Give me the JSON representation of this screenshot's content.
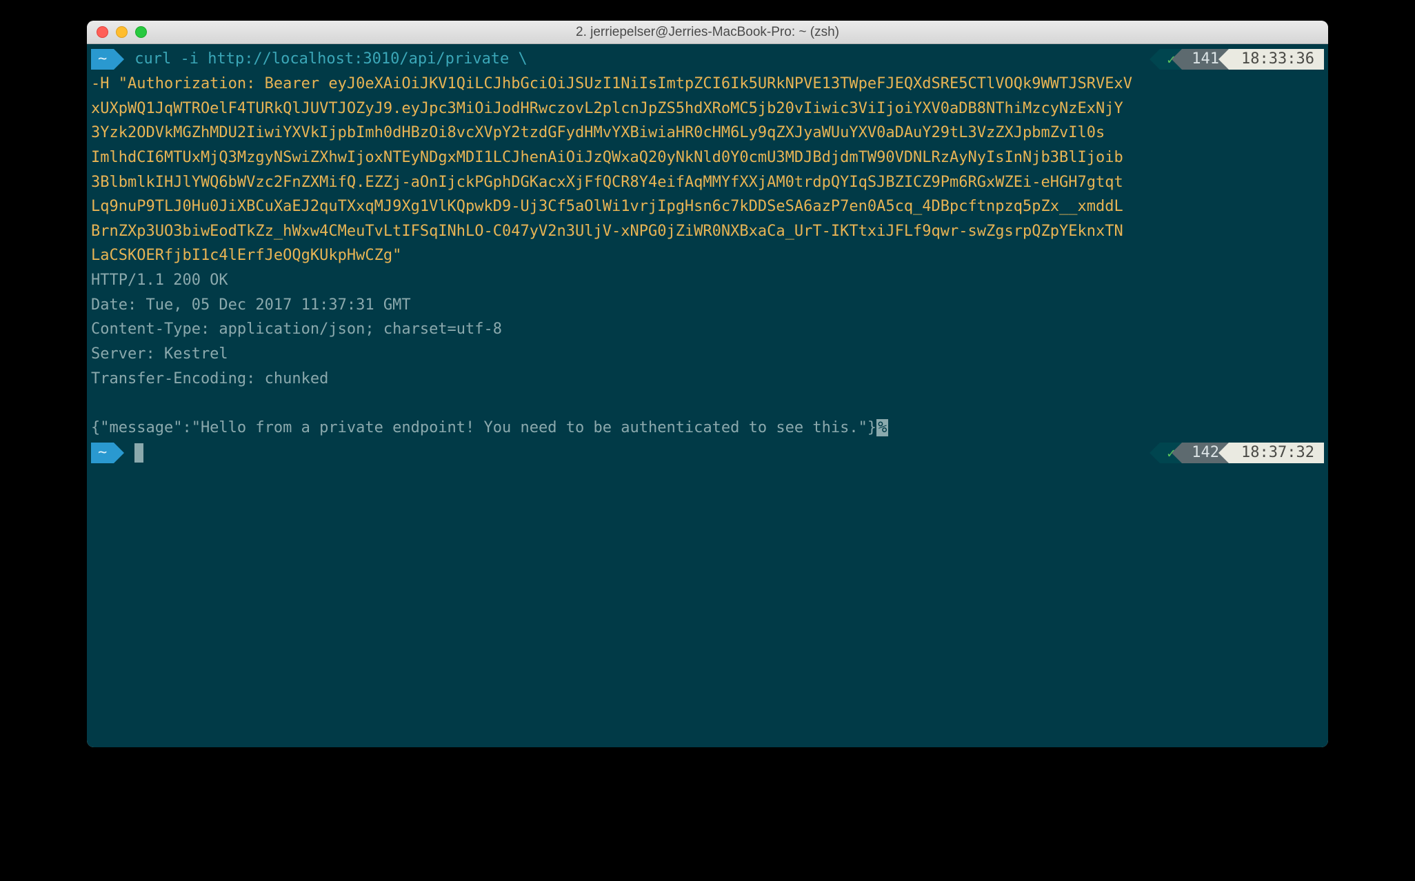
{
  "window": {
    "title": "2. jerriepelser@Jerries-MacBook-Pro: ~ (zsh)"
  },
  "prompt1": {
    "home": "~",
    "command_start": "curl -i http://localhost:3010/api/private \\",
    "check": "✓",
    "count": "141",
    "time": "18:33:36"
  },
  "token_lines": [
    "-H \"Authorization: Bearer eyJ0eXAiOiJKV1QiLCJhbGciOiJSUzI1NiIsImtpZCI6Ik5URkNPVE13TWpeFJEQXdSRE5CTlVOQk9WWTJSRVExV",
    "xUXpWQ1JqWTROelF4TURkQlJUVTJOZyJ9.eyJpc3MiOiJodHRwczovL2plcnJpZS5hdXRoMC5jb20vIiwic3ViIjoiYXV0aDB8NThiMzcyNzExNjY",
    "3Yzk2ODVkMGZhMDU2IiwiYXVkIjpbImh0dHBzOi8vcXVpY2tzdGFydHMvYXBiwiaHR0cHM6Ly9qZXJyaWUuYXV0aDAuY29tL3VzZXJpbmZvIl0s",
    "ImlhdCI6MTUxMjQ3MzgyNSwiZXhwIjoxNTEyNDgxMDI1LCJhenAiOiJzQWxaQ20yNkNld0Y0cmU3MDJBdjdmTW90VDNLRzAyNyIsInNjb3BlIjoib",
    "3BlbmlkIHJlYWQ6bWVzc2FnZXMifQ.EZZj-aOnIjckPGphDGKacxXjFfQCR8Y4eifAqMMYfXXjAM0trdpQYIqSJBZICZ9Pm6RGxWZEi-eHGH7gtqt",
    "Lq9nuP9TLJ0Hu0JiXBCuXaEJ2quTXxqMJ9Xg1VlKQpwkD9-Uj3Cf5aOlWi1vrjIpgHsn6c7kDDSeSA6azP7en0A5cq_4DBpcftnpzq5pZx__xmddL",
    "BrnZXp3UO3biwEodTkZz_hWxw4CMeuTvLtIFSqINhLO-C047yV2n3UljV-xNPG0jZiWR0NXBxaCa_UrT-IKTtxiJFLf9qwr-swZgsrpQZpYEknxTN",
    "LaCSKOERfjbI1c4lErfJeOQgKUkpHwCZg\""
  ],
  "response_lines": [
    "HTTP/1.1 200 OK",
    "Date: Tue, 05 Dec 2017 11:37:31 GMT",
    "Content-Type: application/json; charset=utf-8",
    "Server: Kestrel",
    "Transfer-Encoding: chunked"
  ],
  "json_response": "{\"message\":\"Hello from a private endpoint! You need to be authenticated to see this.\"}",
  "percent": "%",
  "prompt2": {
    "home": "~",
    "check": "✓",
    "count": "142",
    "time": "18:37:32"
  }
}
